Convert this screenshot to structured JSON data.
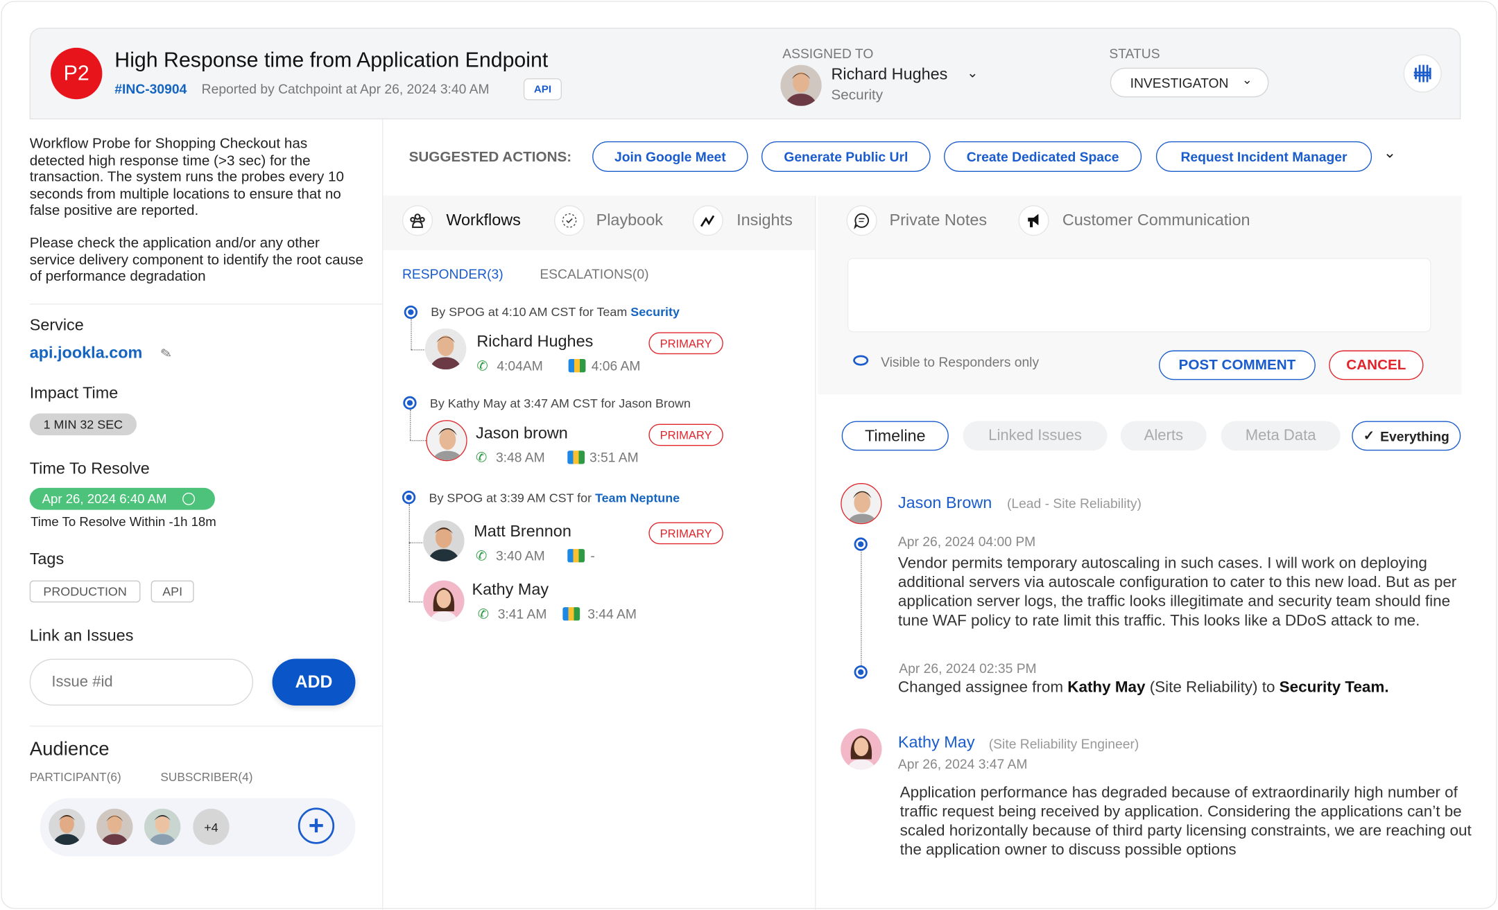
{
  "header": {
    "priority": "P2",
    "title": "High Response time from Application Endpoint",
    "incident_id": "#INC-30904",
    "reported": "Reported by Catchpoint at Apr 26, 2024 3:40 AM",
    "source_badge": "API",
    "assigned_label": "ASSIGNED TO",
    "assignee_name": "Richard Hughes",
    "assignee_team": "Security",
    "status_label": "STATUS",
    "status_value": "INVESTIGATON",
    "brand_icon": "catchpoint-logo-icon"
  },
  "sidebar": {
    "description_1": "Workflow Probe for Shopping Checkout  has detected high response time (>3 sec) for the transaction. The system runs the probes every 10 seconds from multiple locations to ensure that no false positive are reported.",
    "description_2": "Please check the application and/or any other service delivery component to identify the root cause of performance degradation",
    "service_label": "Service",
    "service_value": "api.jookla.com",
    "impact_label": "Impact Time",
    "impact_value": "1 MIN 32 SEC",
    "resolve_label": "Time To Resolve",
    "resolve_value": "Apr 26, 2024 6:40 AM",
    "resolve_within": "Time To Resolve Within -1h 18m",
    "tags_label": "Tags",
    "tags": [
      "PRODUCTION",
      "API"
    ],
    "link_label": "Link an Issues",
    "link_placeholder": "Issue #id",
    "add_label": "ADD",
    "audience_label": "Audience",
    "participants_label": "PARTICIPANT(6)",
    "subscribers_label": "SUBSCRIBER(4)",
    "more_count": "+4"
  },
  "suggested": {
    "label": "SUGGESTED ACTIONS:",
    "actions": [
      "Join Google Meet",
      "Generate Public Url",
      "Create Dedicated Space",
      "Request Incident Manager"
    ]
  },
  "workflow_tabs": [
    "Workflows",
    "Playbook",
    "Insights"
  ],
  "responders": {
    "tabs": [
      "RESPONDER(3)",
      "ESCALATIONS(0)"
    ],
    "primary_label": "PRIMARY",
    "groups": [
      {
        "prefix": "By SPOG at 4:10 AM CST for Team ",
        "team": "Security",
        "people": [
          {
            "name": "Richard Hughes",
            "call": "4:04AM",
            "meet": "4:06 AM",
            "primary": true
          }
        ]
      },
      {
        "prefix": "By Kathy May at 3:47 AM CST for Jason Brown",
        "team": "",
        "people": [
          {
            "name": "Jason brown",
            "call": "3:48 AM",
            "meet": "3:51 AM",
            "primary": true
          }
        ]
      },
      {
        "prefix": "By SPOG at 3:39 AM CST for ",
        "team": "Team Neptune",
        "people": [
          {
            "name": "Matt Brennon",
            "call": "3:40 AM",
            "meet": "-",
            "primary": true
          },
          {
            "name": "Kathy May",
            "call": "3:41 AM",
            "meet": "3:44 AM",
            "primary": false
          }
        ]
      }
    ]
  },
  "notes": {
    "tabs": [
      "Private Notes",
      "Customer Communication"
    ],
    "visibility": "Visible to Responders only",
    "post_label": "POST COMMENT",
    "cancel_label": "CANCEL"
  },
  "timeline": {
    "filters": [
      "Timeline",
      "Linked Issues",
      "Alerts",
      "Meta Data",
      "Everything"
    ],
    "entries": [
      {
        "name": "Jason Brown",
        "role": "(Lead - Site Reliability)",
        "items": [
          {
            "date": "Apr 26, 2024 04:00 PM",
            "text": "Vendor permits temporary autoscaling in such cases. I will work on deploying additional servers via autoscale configuration  to cater to this new load.  But as per application server logs, the traffic looks illegitimate and security team should fine tune WAF policy to rate limit this traffic. This looks like a DDoS attack to me."
          },
          {
            "date": "Apr 26, 2024 02:35 PM",
            "text_a": "Changed assignee from ",
            "bold_a": "Kathy May",
            "text_b": " (Site Reliability) to  ",
            "bold_b": "Security Team."
          }
        ]
      },
      {
        "name": "Kathy May",
        "role": "(Site Reliability Engineer)",
        "date": "Apr 26, 2024 3:47 AM",
        "text": "Application performance has degraded because of extraordinarily high number of traffic request being received by application. Considering the applications can’t be scaled horizontally because of third party licensing constraints, we are reaching out the application owner to discuss possible options"
      }
    ]
  },
  "colors": {
    "accent": "#1a5ccc",
    "priority": "#e8141b",
    "primary_badge": "#e0262c",
    "resolve_pill": "#4cc27a"
  }
}
